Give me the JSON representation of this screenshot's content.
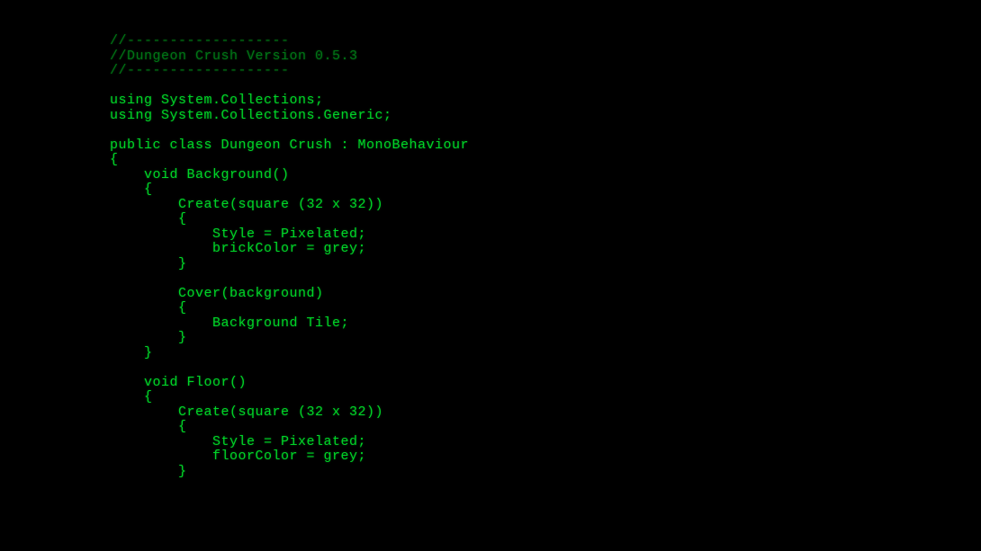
{
  "code": {
    "lines": [
      {
        "text": "//-------------------",
        "comment": true
      },
      {
        "text": "//Dungeon Crush Version 0.5.3",
        "comment": true
      },
      {
        "text": "//-------------------",
        "comment": true
      },
      {
        "text": "",
        "blank": true
      },
      {
        "text": "using System.Collections;",
        "comment": false
      },
      {
        "text": "using System.Collections.Generic;",
        "comment": false
      },
      {
        "text": "",
        "blank": true
      },
      {
        "text": "public class Dungeon Crush : MonoBehaviour",
        "comment": false
      },
      {
        "text": "{",
        "comment": false
      },
      {
        "text": "    void Background()",
        "comment": false
      },
      {
        "text": "    {",
        "comment": false
      },
      {
        "text": "        Create(square (32 x 32))",
        "comment": false
      },
      {
        "text": "        {",
        "comment": false
      },
      {
        "text": "            Style = Pixelated;",
        "comment": false
      },
      {
        "text": "            brickColor = grey;",
        "comment": false
      },
      {
        "text": "        }",
        "comment": false
      },
      {
        "text": "",
        "blank": true
      },
      {
        "text": "        Cover(background)",
        "comment": false
      },
      {
        "text": "        {",
        "comment": false
      },
      {
        "text": "            Background Tile;",
        "comment": false
      },
      {
        "text": "        }",
        "comment": false
      },
      {
        "text": "    }",
        "comment": false
      },
      {
        "text": "",
        "blank": true
      },
      {
        "text": "    void Floor()",
        "comment": false
      },
      {
        "text": "    {",
        "comment": false
      },
      {
        "text": "        Create(square (32 x 32))",
        "comment": false
      },
      {
        "text": "        {",
        "comment": false
      },
      {
        "text": "            Style = Pixelated;",
        "comment": false
      },
      {
        "text": "            floorColor = grey;",
        "comment": false
      },
      {
        "text": "        }",
        "comment": false
      }
    ]
  }
}
